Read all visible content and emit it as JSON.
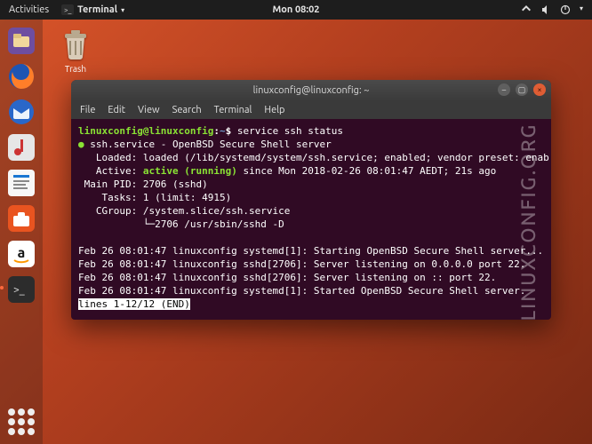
{
  "panel": {
    "activities": "Activities",
    "active_app": "Terminal",
    "clock": "Mon 08:02",
    "indicators": {
      "network": "network-icon",
      "sound": "sound-icon",
      "power": "power-icon",
      "chevron": "▾"
    }
  },
  "desktop": {
    "trash_label": "Trash"
  },
  "dock": {
    "items": [
      {
        "name": "nautilus-files"
      },
      {
        "name": "firefox"
      },
      {
        "name": "thunderbird"
      },
      {
        "name": "rhythmbox"
      },
      {
        "name": "libreoffice-writer"
      },
      {
        "name": "ubuntu-software"
      },
      {
        "name": "amazon"
      },
      {
        "name": "terminal",
        "active": true
      }
    ]
  },
  "terminal": {
    "title": "linuxconfig@linuxconfig: ~",
    "menu": [
      "File",
      "Edit",
      "View",
      "Search",
      "Terminal",
      "Help"
    ],
    "prompt": {
      "user_host": "linuxconfig@linuxconfig",
      "sep": ":",
      "path": "~",
      "sigil": "$"
    },
    "command": "service ssh status",
    "lines": {
      "l1": "ssh.service - OpenBSD Secure Shell server",
      "l2": "   Loaded: loaded (/lib/systemd/system/ssh.service; enabled; vendor preset: enab",
      "l3a": "   Active: ",
      "l3b": "active (running)",
      "l3c": " since Mon 2018-02-26 08:01:47 AEDT; 21s ago",
      "l4": " Main PID: 2706 (sshd)",
      "l5": "    Tasks: 1 (limit: 4915)",
      "l6": "   CGroup: /system.slice/ssh.service",
      "l7": "           └─2706 /usr/sbin/sshd -D",
      "blank": "",
      "j1": "Feb 26 08:01:47 linuxconfig systemd[1]: Starting OpenBSD Secure Shell server...",
      "j2": "Feb 26 08:01:47 linuxconfig sshd[2706]: Server listening on 0.0.0.0 port 22.",
      "j3": "Feb 26 08:01:47 linuxconfig sshd[2706]: Server listening on :: port 22.",
      "j4": "Feb 26 08:01:47 linuxconfig systemd[1]: Started OpenBSD Secure Shell server.",
      "end": "lines 1-12/12 (END)"
    },
    "bullet": "●"
  },
  "watermark": "LINUXCONFIG.ORG"
}
